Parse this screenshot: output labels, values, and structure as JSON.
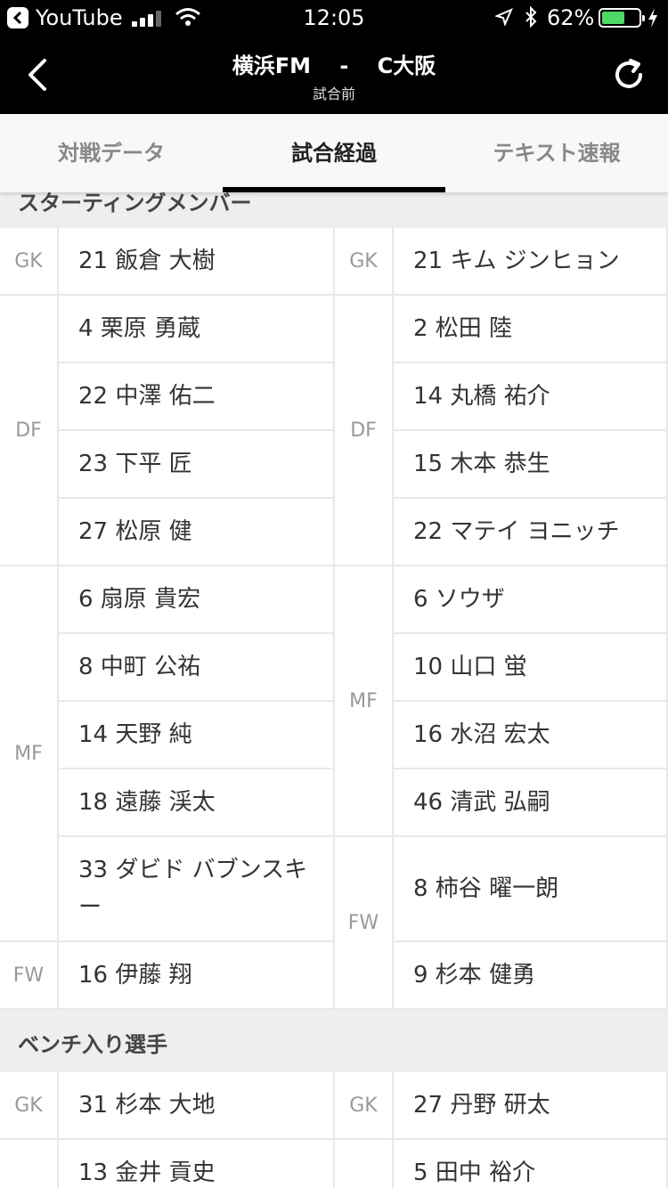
{
  "status_bar": {
    "back_app": "YouTube",
    "time": "12:05",
    "battery_percent": "62%",
    "battery_level": 0.62,
    "icons": [
      "back-app-icon",
      "signal-icon",
      "wifi-icon",
      "location-icon",
      "bluetooth-icon",
      "battery-icon",
      "charging-icon"
    ]
  },
  "header": {
    "title": "横浜FM　 -　 C大阪",
    "subtitle": "試合前"
  },
  "tabs": [
    {
      "label": "対戦データ",
      "active": false
    },
    {
      "label": "試合経過",
      "active": true
    },
    {
      "label": "テキスト速報",
      "active": false
    }
  ],
  "starting": {
    "heading": "スターティングメンバー",
    "home": [
      {
        "position": "GK",
        "players": [
          "21 飯倉 大樹"
        ]
      },
      {
        "position": "DF",
        "players": [
          "4 栗原 勇蔵",
          "22 中澤 佑二",
          "23 下平 匠",
          "27 松原 健"
        ]
      },
      {
        "position": "MF",
        "players": [
          "6 扇原 貴宏",
          "8 中町 公祐",
          "14 天野 純",
          "18 遠藤 渓太",
          "33 ダビド バブンスキー"
        ]
      },
      {
        "position": "FW",
        "players": [
          "16 伊藤 翔"
        ]
      }
    ],
    "away": [
      {
        "position": "GK",
        "players": [
          "21 キム ジンヒョン"
        ]
      },
      {
        "position": "DF",
        "players": [
          "2 松田 陸",
          "14 丸橋 祐介",
          "15 木本 恭生",
          "22 マテイ ヨニッチ"
        ]
      },
      {
        "position": "MF",
        "players": [
          "6 ソウザ",
          "10 山口 蛍",
          "16 水沼 宏太",
          "46 清武 弘嗣"
        ]
      },
      {
        "position": "FW",
        "players": [
          "8 柿谷 曜一朗",
          "9 杉本 健勇"
        ]
      }
    ]
  },
  "bench": {
    "heading": "ベンチ入り選手",
    "home": [
      {
        "position": "GK",
        "players": [
          "31 杉本 大地"
        ]
      },
      {
        "position": "",
        "players": [
          "13 金井 貢史"
        ]
      }
    ],
    "away": [
      {
        "position": "GK",
        "players": [
          "27 丹野 研太"
        ]
      },
      {
        "position": "",
        "players": [
          "5 田中 裕介"
        ]
      }
    ]
  }
}
